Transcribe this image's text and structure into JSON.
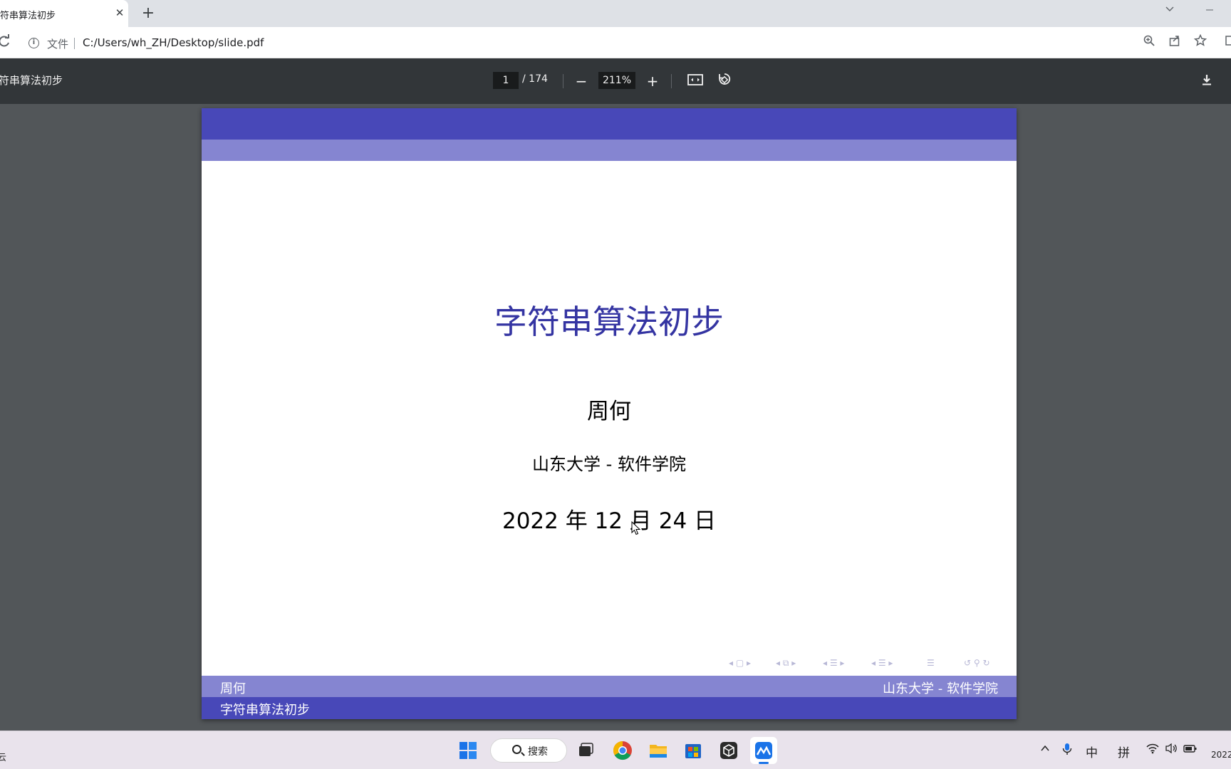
{
  "browser": {
    "tab_title": "符串算法初步",
    "tab_close": "✕",
    "new_tab": "+",
    "address_chip": "文件",
    "url": "C:/Users/wh_ZH/Desktop/slide.pdf"
  },
  "pdf_toolbar": {
    "title": "符串算法初步",
    "page_current": "1",
    "page_total": "/ 174",
    "zoom": "211%",
    "zoom_out": "−",
    "zoom_in": "+"
  },
  "slide": {
    "title": "字符串算法初步",
    "author": "周何",
    "institute": "山东大学 - 软件学院",
    "date": "2022 年 12 月 24 日",
    "footer_author": "周何",
    "footer_institute": "山东大学 - 软件学院",
    "footer_title": "字符串算法初步",
    "colors": {
      "band_dark": "#4848b8",
      "band_light": "#8585d1",
      "title": "#3434a2"
    }
  },
  "taskbar": {
    "weather": "云",
    "search_label": "搜索",
    "ime_lang": "中",
    "ime_mode": "拼",
    "clock": "2022",
    "apps": [
      "windows-start-icon",
      "task-view-icon",
      "chrome-icon",
      "file-explorer-icon",
      "store-icon",
      "app-box-icon",
      "active-app-icon"
    ]
  }
}
